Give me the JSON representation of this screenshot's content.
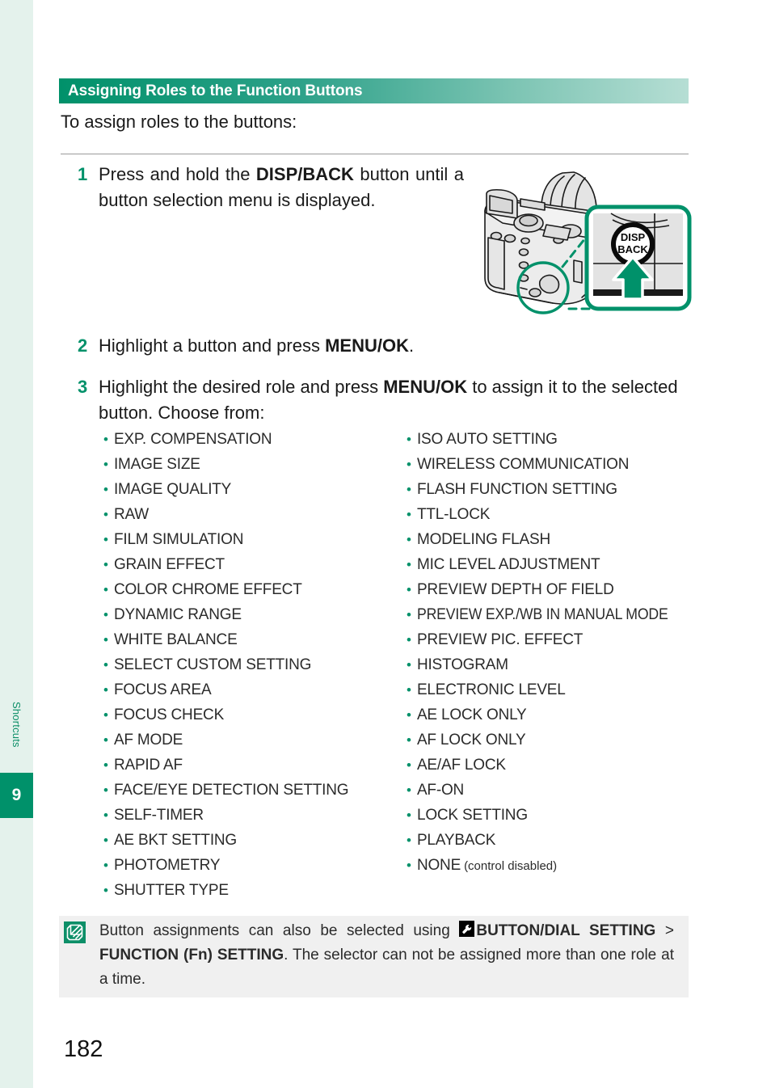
{
  "sidebar": {
    "chapter_label": "Shortcuts",
    "chapter_number": "9",
    "strip_color": "#e4f2ec",
    "accent_color": "#00916a"
  },
  "section": {
    "title": "Assigning Roles to the Function Buttons",
    "intro": "To assign roles to the buttons:"
  },
  "steps": [
    {
      "number": "1",
      "text_before": "Press and hold the ",
      "bold": "DISP/BACK",
      "text_after": " button until a button selection menu is displayed."
    },
    {
      "number": "2",
      "text_before": "Highlight a button and press ",
      "bold": "MENU/OK",
      "text_after": "."
    },
    {
      "number": "3",
      "text_before": "Highlight the desired role and press ",
      "bold": "MENU/OK",
      "text_after": " to assign it to the selected button. Choose from:"
    }
  ],
  "figure": {
    "callout_button_line1": "DISP",
    "callout_button_line2": "BACK",
    "highlight_color": "#00916a",
    "arrow_color": "#00916a"
  },
  "roles": {
    "left_column": [
      "EXP. COMPENSATION",
      "IMAGE SIZE",
      "IMAGE QUALITY",
      "RAW",
      "FILM SIMULATION",
      "GRAIN EFFECT",
      "COLOR CHROME EFFECT",
      "DYNAMIC RANGE",
      "WHITE BALANCE",
      "SELECT CUSTOM SETTING",
      "FOCUS AREA",
      "FOCUS CHECK",
      "AF MODE",
      "RAPID AF",
      "FACE/EYE DETECTION SETTING",
      "SELF-TIMER",
      "AE BKT SETTING",
      "PHOTOMETRY",
      "SHUTTER TYPE"
    ],
    "right_column": [
      "ISO AUTO SETTING",
      "WIRELESS COMMUNICATION",
      "FLASH FUNCTION SETTING",
      "TTL-LOCK",
      "MODELING FLASH",
      "MIC LEVEL ADJUSTMENT",
      "PREVIEW DEPTH OF FIELD",
      "PREVIEW EXP./WB IN MANUAL MODE",
      "PREVIEW PIC. EFFECT",
      "HISTOGRAM",
      "ELECTRONIC LEVEL",
      "AE LOCK ONLY",
      "AF LOCK ONLY",
      "AE/AF LOCK",
      "AF-ON",
      "LOCK SETTING",
      "PLAYBACK",
      "NONE"
    ],
    "right_column_last_note": "(control disabled)"
  },
  "note": {
    "icon_name": "tip-note-icon",
    "menu_icon_name": "wrench-setup-icon",
    "part1": "Button assignments can also be selected using ",
    "bold1": "BUTTON/DIAL SETTING",
    "separator": " > ",
    "bold2": "FUNCTION (Fn) SETTING",
    "part2": ". The selector can not be assigned more than one role at a time."
  },
  "page_number": "182"
}
